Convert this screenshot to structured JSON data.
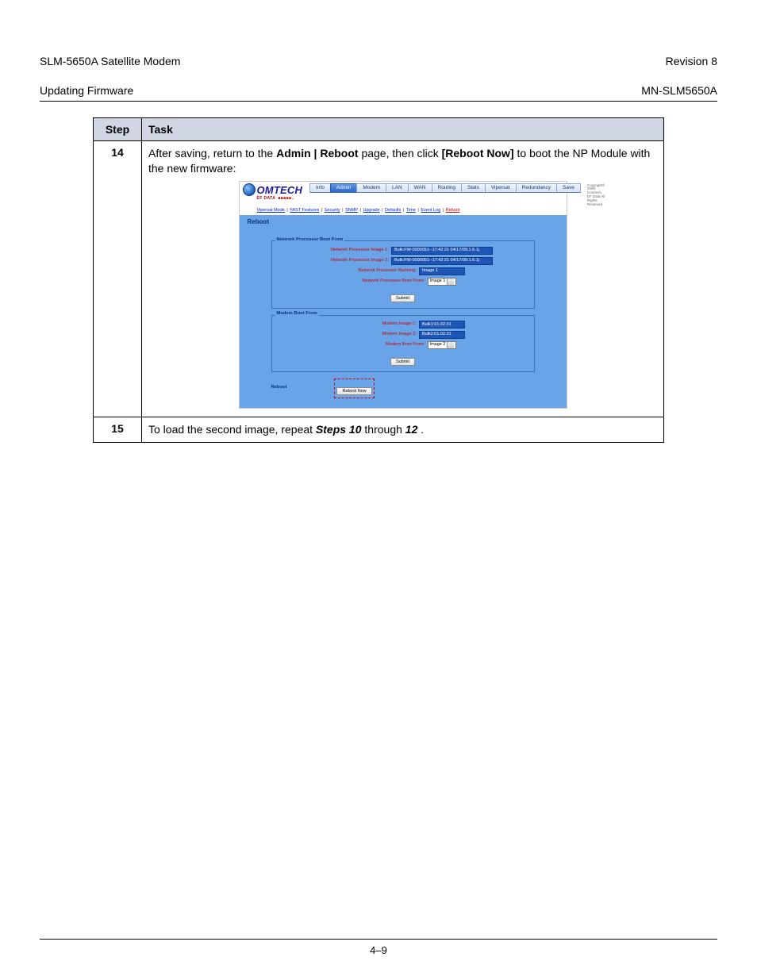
{
  "doc": {
    "title_left_line1": "SLM-5650A Satellite Modem",
    "title_left_line2": "Updating Firmware",
    "title_right_line1": "Revision 8",
    "title_right_line2": "MN-SLM5650A",
    "page_number": "4–9"
  },
  "table": {
    "head_step": "Step",
    "head_task": "Task",
    "row14": {
      "num": "14",
      "text_pre": "After saving, return to the ",
      "text_bold1": "Admin | Reboot",
      "text_mid1": " page, then click ",
      "text_bold2": "[Reboot Now]",
      "text_mid2": " to boot the NP Module with the new firmware:"
    },
    "row15": {
      "num": "15",
      "text_pre": "To load the second image, repeat ",
      "text_bold1": "Steps 10",
      "text_mid1": " through ",
      "text_bold2": "12",
      "text_post": "."
    }
  },
  "shot": {
    "logo_main": "OMTECH",
    "logo_sub1": "EF DATA",
    "logo_sub2": "■■■■■..",
    "copyright": "Copyright© 2009 Comtech EF Data All Rights Reserved",
    "topnav": [
      "Info",
      "Admin",
      "Modem",
      "LAN",
      "WAN",
      "Routing",
      "Stats",
      "Vipersat",
      "Redundancy",
      "Save"
    ],
    "topnav_active_index": 1,
    "subnav": [
      "Vipersat Mode",
      "FAST Features",
      "Security",
      "SNMP",
      "Upgrade",
      "Defaults",
      "Time",
      "Event Log",
      "Reboot"
    ],
    "subnav_red_index": 8,
    "page_title": "Reboot",
    "np_panel": {
      "legend": "Network Processor Boot From",
      "rows": [
        {
          "label": "Network Processor Image 1:",
          "value": "Bulk:FW-0000051--17:42:21 04/17/09;1.6.1j"
        },
        {
          "label": "Network Processor Image 2:",
          "value": "Bulk:FW-0000051--17:42:21 04/17/09;1.6.1j"
        },
        {
          "label": "Network Processor Running:",
          "value": "Image 1",
          "short": true
        }
      ],
      "select_label": "Network Processor Boot From:",
      "select_value": "Image 1",
      "submit": "Submit"
    },
    "modem_panel": {
      "legend": "Modem Boot From",
      "rows": [
        {
          "label": "Modem Image 1:",
          "value": "Bulk1:01.02.01",
          "short": true
        },
        {
          "label": "Modem Image 2:",
          "value": "Bulk2:01.02.01",
          "short": true
        }
      ],
      "select_label": "Modem Boot From:",
      "select_value": "Image 2",
      "submit": "Submit"
    },
    "reboot_panel": {
      "legend": "Reboot",
      "button": "Reboot Now"
    }
  }
}
